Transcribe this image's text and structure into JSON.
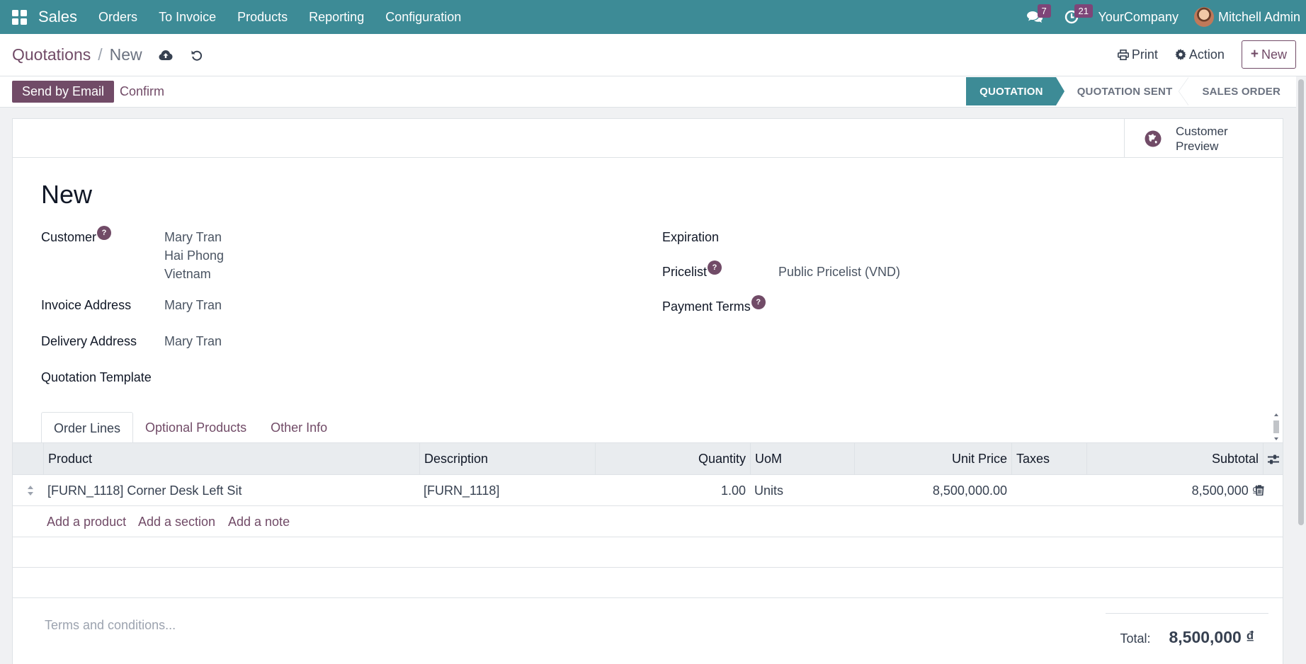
{
  "navbar": {
    "app_name": "Sales",
    "menu": [
      "Orders",
      "To Invoice",
      "Products",
      "Reporting",
      "Configuration"
    ],
    "messages_count": "7",
    "activities_count": "21",
    "company": "YourCompany",
    "user": "Mitchell Admin"
  },
  "breadcrumb": {
    "parent": "Quotations",
    "separator": "/",
    "current": "New"
  },
  "control": {
    "print_label": "Print",
    "action_label": "Action",
    "new_label": "New"
  },
  "statusbar": {
    "send_email_label": "Send by Email",
    "confirm_label": "Confirm",
    "stages": [
      "QUOTATION",
      "QUOTATION SENT",
      "SALES ORDER"
    ],
    "active_stage": "QUOTATION"
  },
  "button_box": {
    "customer_preview_label": "Customer Preview"
  },
  "form": {
    "title": "New",
    "customer_label": "Customer",
    "customer_name": "Mary Tran",
    "customer_city": "Hai Phong",
    "customer_country": "Vietnam",
    "invoice_address_label": "Invoice Address",
    "invoice_address_value": "Mary Tran",
    "delivery_address_label": "Delivery Address",
    "delivery_address_value": "Mary Tran",
    "quotation_template_label": "Quotation Template",
    "expiration_label": "Expiration",
    "pricelist_label": "Pricelist",
    "pricelist_value": "Public Pricelist (VND)",
    "payment_terms_label": "Payment Terms",
    "help_mark": "?"
  },
  "tabs": [
    "Order Lines",
    "Optional Products",
    "Other Info"
  ],
  "order_lines": {
    "columns": [
      "Product",
      "Description",
      "Quantity",
      "UoM",
      "Unit Price",
      "Taxes",
      "Subtotal"
    ],
    "rows": [
      {
        "product": "[FURN_1118] Corner Desk Left Sit",
        "description": "[FURN_1118]",
        "quantity": "1.00",
        "uom": "Units",
        "unit_price": "8,500,000.00",
        "taxes": "",
        "subtotal": "8,500,000 ₫"
      }
    ],
    "add_product_label": "Add a product",
    "add_section_label": "Add a section",
    "add_note_label": "Add a note"
  },
  "footer": {
    "terms_placeholder": "Terms and conditions...",
    "total_label": "Total:",
    "total_value": "8,500,000 ₫"
  },
  "colors": {
    "navbar": "#3d8b96",
    "primary": "#714b67",
    "stage_active": "#3d8b96"
  }
}
